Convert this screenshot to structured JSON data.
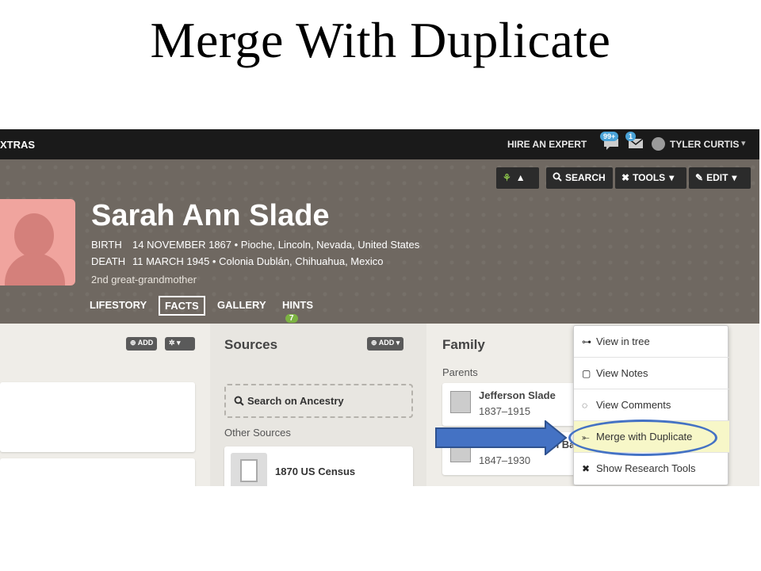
{
  "slide": {
    "title": "Merge With Duplicate"
  },
  "topbar": {
    "extras": "XTRAS",
    "hire_expert": "HIRE AN EXPERT",
    "notif_badge": "99+",
    "mail_badge": "1",
    "user_name": "TYLER CURTIS",
    "user_chevron": "▾"
  },
  "person": {
    "name": "Sarah Ann Slade",
    "birth_label": "BIRTH",
    "birth_value": "14 NOVEMBER 1867 • Pioche, Lincoln, Nevada, United States",
    "death_label": "DEATH",
    "death_value": "11 MARCH 1945 • Colonia Dublán, Chihuahua, Mexico",
    "relation": "2nd great-grandmother"
  },
  "tabs": {
    "lifestory": "LIFESTORY",
    "facts": "FACTS",
    "gallery": "GALLERY",
    "hints": "HINTS",
    "hints_count": "7",
    "active": "FACTS"
  },
  "toolbar": {
    "search": "SEARCH",
    "tools": "TOOLS",
    "edit": "EDIT"
  },
  "tools_menu": {
    "items": [
      {
        "label": "View in tree",
        "icon": "tree-icon"
      },
      {
        "label": "View Notes",
        "icon": "notes-icon"
      },
      {
        "label": "View Comments",
        "icon": "comments-icon"
      },
      {
        "label": "Merge with Duplicate",
        "icon": "merge-icon"
      },
      {
        "label": "Show Research Tools",
        "icon": "research-tools-icon"
      }
    ],
    "highlighted": "Merge with Duplicate"
  },
  "facts_panel": {
    "add_label": "ADD"
  },
  "sources": {
    "title": "Sources",
    "add_label": "ADD",
    "search_label": "Search on Ancestry",
    "other_sources": "Other Sources",
    "items": [
      {
        "name": "1870 US Census"
      }
    ]
  },
  "family": {
    "title": "Family",
    "parents_label": "Parents",
    "parents": [
      {
        "name": "Jefferson Slade",
        "years": "1837–1915"
      },
      {
        "name": "Sarah Johannah Barron",
        "years": "1847–1930"
      }
    ]
  },
  "colors": {
    "header_bg": "#6f6861",
    "topbar_bg": "#1a1a1a",
    "highlight_oval": "#4472c4",
    "arrow_fill": "#4472c4",
    "hints_badge": "#7cb342"
  }
}
